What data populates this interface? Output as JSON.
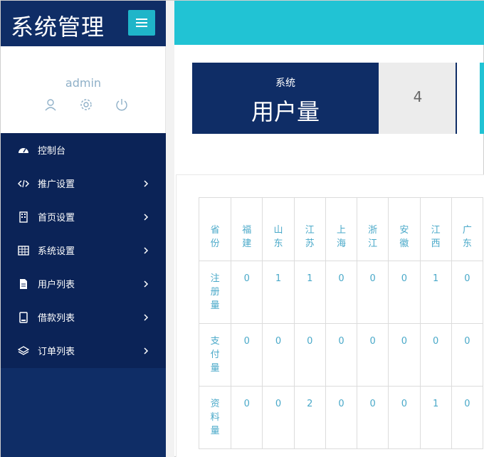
{
  "app": {
    "title": "系统管理"
  },
  "profile": {
    "username": "admin",
    "icons": [
      "user-icon",
      "gear-icon",
      "power-icon"
    ]
  },
  "nav": {
    "items": [
      {
        "label": "控制台",
        "icon": "dashboard-icon",
        "has_children": false
      },
      {
        "label": "推广设置",
        "icon": "code-icon",
        "has_children": true
      },
      {
        "label": "首页设置",
        "icon": "building-icon",
        "has_children": true
      },
      {
        "label": "系统设置",
        "icon": "grid-icon",
        "has_children": true
      },
      {
        "label": "用户列表",
        "icon": "document-icon",
        "has_children": true
      },
      {
        "label": "借款列表",
        "icon": "file-icon",
        "has_children": true
      },
      {
        "label": "订单列表",
        "icon": "layers-icon",
        "has_children": true
      }
    ]
  },
  "stat": {
    "subtitle": "系统",
    "title": "用户量",
    "value": "4"
  },
  "table": {
    "columns": [
      "省份",
      "福建",
      "山东",
      "江苏",
      "上海",
      "浙江",
      "安徽",
      "江西",
      "广东"
    ],
    "rows": [
      {
        "label": "注册量",
        "values": [
          "0",
          "1",
          "1",
          "0",
          "0",
          "0",
          "1",
          "0"
        ]
      },
      {
        "label": "支付量",
        "values": [
          "0",
          "0",
          "0",
          "0",
          "0",
          "0",
          "0",
          "0"
        ]
      },
      {
        "label": "资料量",
        "values": [
          "0",
          "0",
          "2",
          "0",
          "0",
          "0",
          "1",
          "0"
        ]
      }
    ]
  },
  "colors": {
    "sidebar": "#0f2d66",
    "nav": "#0b2357",
    "accent": "#21c3d4",
    "table_text": "#4aa9c9"
  }
}
